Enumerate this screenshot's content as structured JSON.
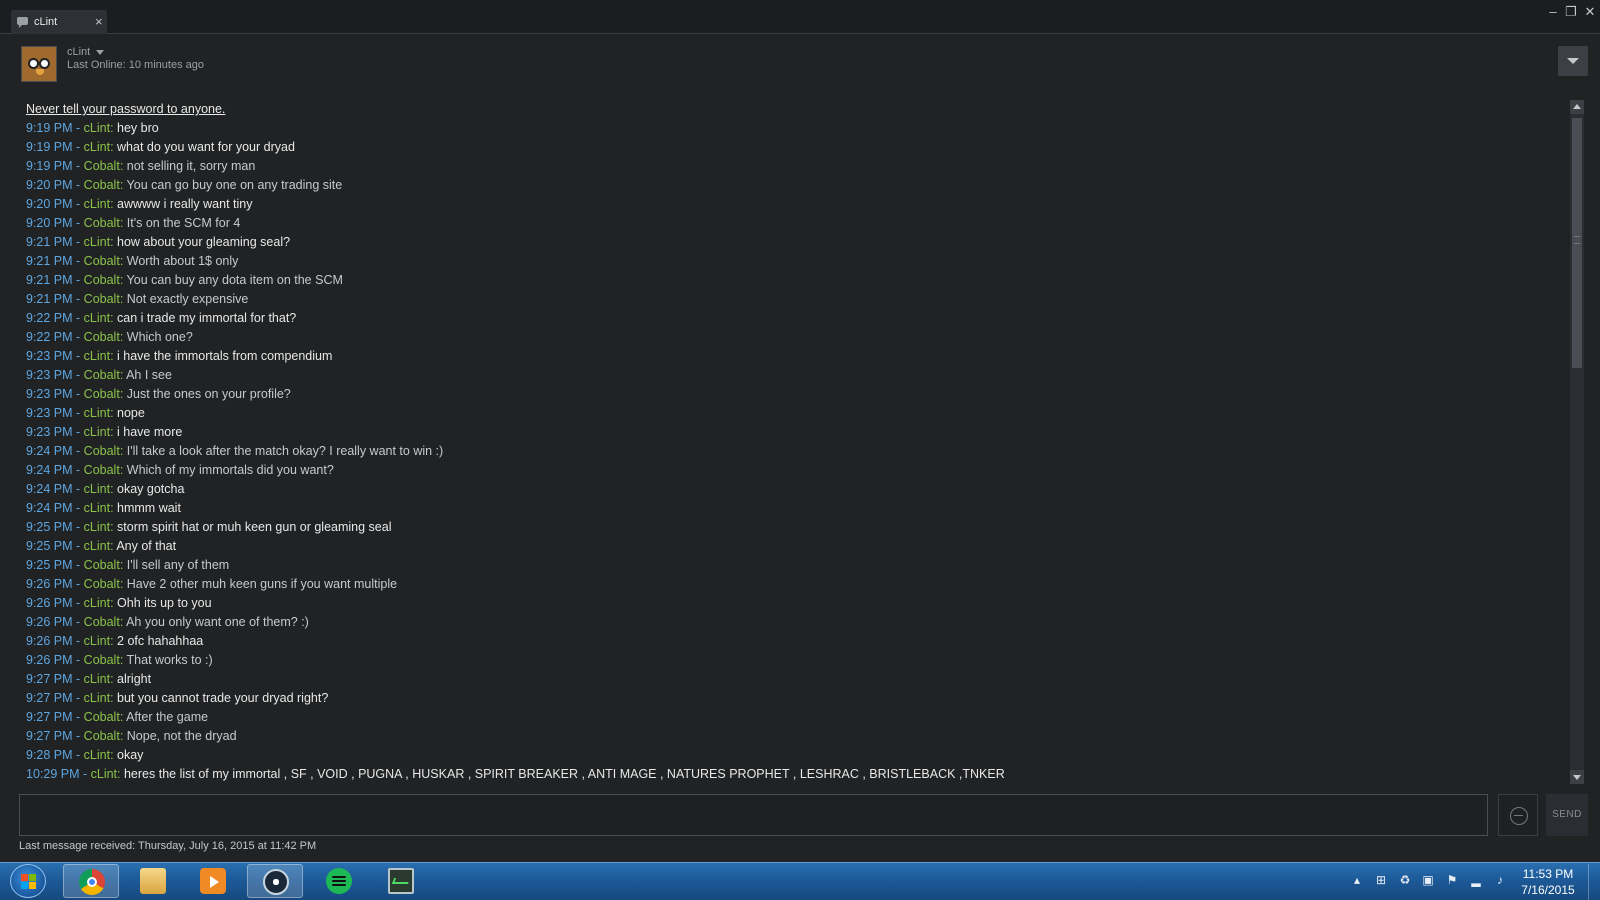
{
  "window": {
    "tab_label": "cLint",
    "tab_close": "×",
    "controls": {
      "minimize": "–",
      "restore": "❐",
      "close": "✕"
    }
  },
  "friend": {
    "name": "cLint",
    "last_online": "Last Online: 10 minutes ago"
  },
  "chat": {
    "warning": "Never tell your password to anyone.",
    "messages": [
      {
        "time": "9:19 PM",
        "sender": "cLint",
        "text": "hey bro"
      },
      {
        "time": "9:19 PM",
        "sender": "cLint",
        "text": "what do you want for your dryad"
      },
      {
        "time": "9:19 PM",
        "sender": "Cobalt",
        "text": "not selling it, sorry man"
      },
      {
        "time": "9:20 PM",
        "sender": "Cobalt",
        "text": "You can go buy one on any trading site"
      },
      {
        "time": "9:20 PM",
        "sender": "cLint",
        "text": "awwww i really want tiny"
      },
      {
        "time": "9:20 PM",
        "sender": "Cobalt",
        "text": "It's on the SCM for 4"
      },
      {
        "time": "9:21 PM",
        "sender": "cLint",
        "text": "how about your gleaming seal?"
      },
      {
        "time": "9:21 PM",
        "sender": "Cobalt",
        "text": "Worth about 1$ only"
      },
      {
        "time": "9:21 PM",
        "sender": "Cobalt",
        "text": "You can buy any dota item on the SCM"
      },
      {
        "time": "9:21 PM",
        "sender": "Cobalt",
        "text": "Not exactly expensive"
      },
      {
        "time": "9:22 PM",
        "sender": "cLint",
        "text": "can i trade my immortal for that?"
      },
      {
        "time": "9:22 PM",
        "sender": "Cobalt",
        "text": "Which one?"
      },
      {
        "time": "9:23 PM",
        "sender": "cLint",
        "text": "i have the immortals from compendium"
      },
      {
        "time": "9:23 PM",
        "sender": "Cobalt",
        "text": "Ah I see"
      },
      {
        "time": "9:23 PM",
        "sender": "Cobalt",
        "text": "Just the ones on your profile?"
      },
      {
        "time": "9:23 PM",
        "sender": "cLint",
        "text": "nope"
      },
      {
        "time": "9:23 PM",
        "sender": "cLint",
        "text": "i have more"
      },
      {
        "time": "9:24 PM",
        "sender": "Cobalt",
        "text": "I'll take a look after the match okay? I really want to win :)"
      },
      {
        "time": "9:24 PM",
        "sender": "Cobalt",
        "text": "Which of my immortals did you want?"
      },
      {
        "time": "9:24 PM",
        "sender": "cLint",
        "text": "okay gotcha"
      },
      {
        "time": "9:24 PM",
        "sender": "cLint",
        "text": "hmmm wait"
      },
      {
        "time": "9:25 PM",
        "sender": "cLint",
        "text": "storm spirit hat or muh keen gun or gleaming seal"
      },
      {
        "time": "9:25 PM",
        "sender": "cLint",
        "text": "Any of that"
      },
      {
        "time": "9:25 PM",
        "sender": "Cobalt",
        "text": "I'll sell any of them"
      },
      {
        "time": "9:26 PM",
        "sender": "Cobalt",
        "text": "Have 2 other muh keen guns if you want multiple"
      },
      {
        "time": "9:26 PM",
        "sender": "cLint",
        "text": "Ohh its up to you"
      },
      {
        "time": "9:26 PM",
        "sender": "Cobalt",
        "text": "Ah you only want one of them? :)"
      },
      {
        "time": "9:26 PM",
        "sender": "cLint",
        "text": "2 ofc hahahhaa"
      },
      {
        "time": "9:26 PM",
        "sender": "Cobalt",
        "text": "That works to :)"
      },
      {
        "time": "9:27 PM",
        "sender": "cLint",
        "text": "alright"
      },
      {
        "time": "9:27 PM",
        "sender": "cLint",
        "text": "but you cannot trade your dryad right?"
      },
      {
        "time": "9:27 PM",
        "sender": "Cobalt",
        "text": "After the game"
      },
      {
        "time": "9:27 PM",
        "sender": "Cobalt",
        "text": "Nope, not the dryad"
      },
      {
        "time": "9:28 PM",
        "sender": "cLint",
        "text": "okay"
      },
      {
        "time": "10:29 PM",
        "sender": "cLint",
        "text": "heres the list of my immortal ,  SF , VOID , PUGNA , HUSKAR , SPIRIT BREAKER , ANTI MAGE , NATURES PROPHET , LESHRAC , BRISTLEBACK ,TNKER"
      }
    ]
  },
  "composer": {
    "value": "",
    "send_label": "SEND"
  },
  "status": {
    "last_message": "Last message received: Thursday, July 16, 2015 at 11:42 PM"
  },
  "taskbar": {
    "time": "11:53 PM",
    "date": "7/16/2015"
  },
  "colors": {
    "timestamp": "#5ea6e0",
    "sender": "#8bc34a",
    "background": "#202224",
    "taskbar": "#1d5a98"
  }
}
